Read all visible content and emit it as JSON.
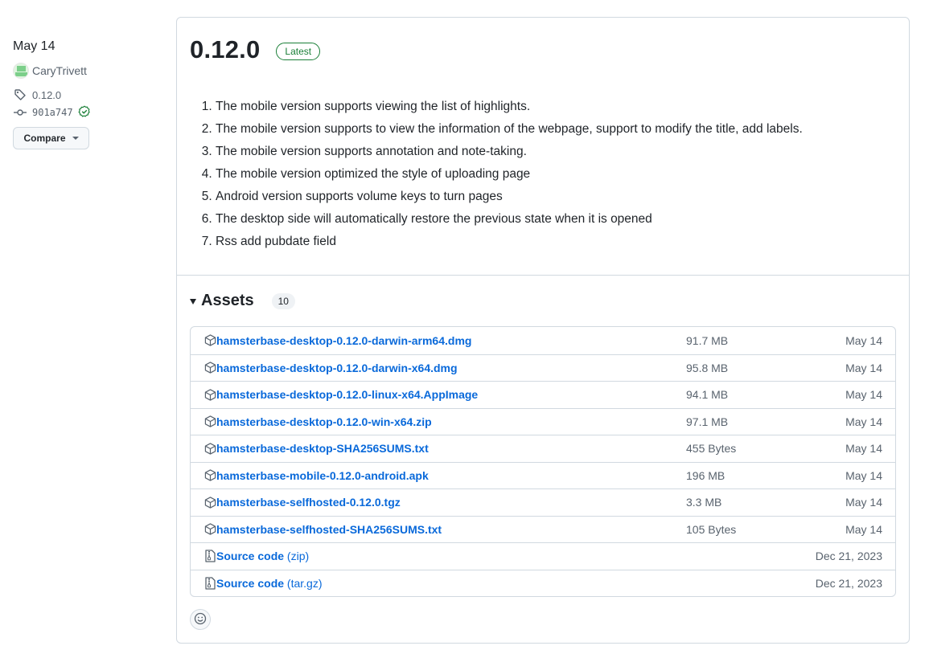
{
  "sidebar": {
    "date": "May 14",
    "author": "CaryTrivett",
    "tag": "0.12.0",
    "commit": "901a747",
    "compare_label": "Compare"
  },
  "release": {
    "title": "0.12.0",
    "badge": "Latest",
    "notes": [
      "The mobile version supports viewing the list of highlights.",
      "The mobile version supports to view the information of the webpage, support to modify the title, add labels.",
      "The mobile version supports annotation and note-taking.",
      "The mobile version optimized the style of uploading page",
      "Android version supports volume keys to turn pages",
      "The desktop side will automatically restore the previous state when it is opened",
      "Rss add pubdate field"
    ]
  },
  "assets": {
    "title": "Assets",
    "count": "10",
    "items": [
      {
        "name": "hamsterbase-desktop-0.12.0-darwin-arm64.dmg",
        "size": "91.7 MB",
        "date": "May 14",
        "icon": "package-icon"
      },
      {
        "name": "hamsterbase-desktop-0.12.0-darwin-x64.dmg",
        "size": "95.8 MB",
        "date": "May 14",
        "icon": "package-icon"
      },
      {
        "name": "hamsterbase-desktop-0.12.0-linux-x64.AppImage",
        "size": "94.1 MB",
        "date": "May 14",
        "icon": "package-icon"
      },
      {
        "name": "hamsterbase-desktop-0.12.0-win-x64.zip",
        "size": "97.1 MB",
        "date": "May 14",
        "icon": "package-icon"
      },
      {
        "name": "hamsterbase-desktop-SHA256SUMS.txt",
        "size": "455 Bytes",
        "date": "May 14",
        "icon": "package-icon"
      },
      {
        "name": "hamsterbase-mobile-0.12.0-android.apk",
        "size": "196 MB",
        "date": "May 14",
        "icon": "package-icon"
      },
      {
        "name": "hamsterbase-selfhosted-0.12.0.tgz",
        "size": "3.3 MB",
        "date": "May 14",
        "icon": "package-icon"
      },
      {
        "name": "hamsterbase-selfhosted-SHA256SUMS.txt",
        "size": "105 Bytes",
        "date": "May 14",
        "icon": "package-icon"
      }
    ],
    "source": [
      {
        "name": "Source code",
        "suffix": "(zip)",
        "date": "Dec 21, 2023",
        "icon": "file-zip-icon"
      },
      {
        "name": "Source code",
        "suffix": "(tar.gz)",
        "date": "Dec 21, 2023",
        "icon": "file-zip-icon"
      }
    ]
  },
  "colors": {
    "link": "#0969da",
    "latest": "#1a7f37",
    "border": "#d1d9e0",
    "muted": "#59636e"
  }
}
